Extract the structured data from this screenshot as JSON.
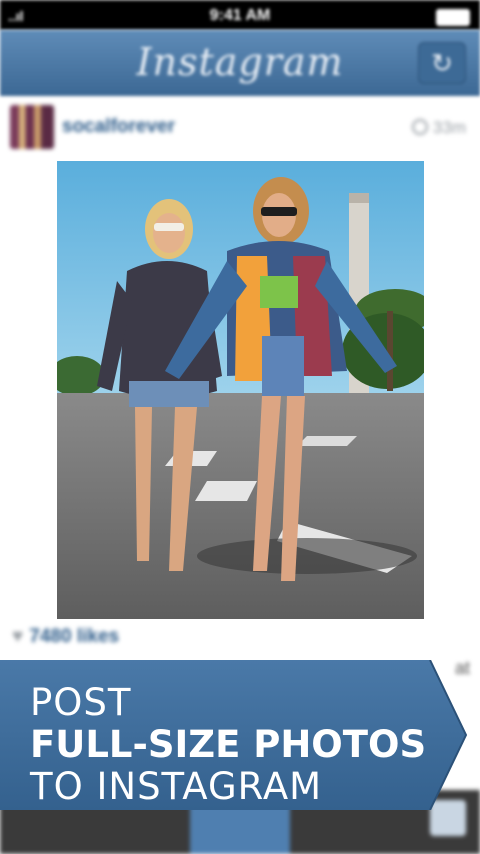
{
  "status_bar": {
    "signal_text": "..ıl",
    "time": "9:41 AM"
  },
  "nav": {
    "title": "Instagram",
    "refresh_symbol": "↻"
  },
  "post": {
    "username": "socalforever",
    "timestamp": "33m",
    "likes": "7480 likes",
    "side_fragment": "at"
  },
  "promo": {
    "line1": "POST",
    "line2": "FULL-SIZE PHOTOS",
    "line3": "TO INSTAGRAM",
    "banner_color": "#3f6e9c"
  },
  "colors": {
    "nav_top": "#5f8cb8",
    "nav_bottom": "#3c6894",
    "link_blue": "#2d5c8a"
  }
}
